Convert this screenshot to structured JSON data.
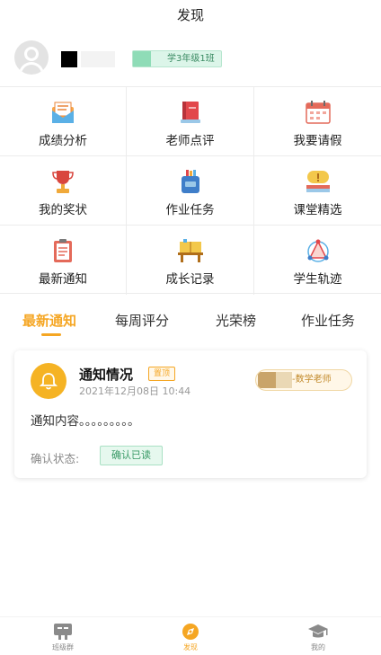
{
  "header": {
    "title": "发现"
  },
  "profile": {
    "class_name": "学3年级1班"
  },
  "grid": {
    "items": [
      {
        "label": "成绩分析",
        "icon": "score-analysis-icon"
      },
      {
        "label": "老师点评",
        "icon": "teacher-comment-icon"
      },
      {
        "label": "我要请假",
        "icon": "calendar-leave-icon"
      },
      {
        "label": "我的奖状",
        "icon": "trophy-icon"
      },
      {
        "label": "作业任务",
        "icon": "homework-bag-icon"
      },
      {
        "label": "课堂精选",
        "icon": "class-highlight-icon"
      },
      {
        "label": "最新通知",
        "icon": "clipboard-notice-icon"
      },
      {
        "label": "成长记录",
        "icon": "growth-record-icon"
      },
      {
        "label": "学生轨迹",
        "icon": "student-trajectory-icon"
      }
    ]
  },
  "tabs": [
    "最新通知",
    "每周评分",
    "光荣榜",
    "作业任务"
  ],
  "notice": {
    "title": "通知情况",
    "pin": "置顶",
    "time": "2021年12月08日 10:44",
    "teacher": "-数学老师",
    "content": "通知内容。。。。。。。。。",
    "confirm_label": "确认状态:",
    "confirm_status": "确认已读"
  },
  "bottom_nav": [
    {
      "label": "班级群",
      "icon": "class-group-icon"
    },
    {
      "label": "发现",
      "icon": "discover-compass-icon"
    },
    {
      "label": "我的",
      "icon": "graduation-cap-icon"
    }
  ],
  "colors": {
    "accent": "#f5a623",
    "green": "#3a9a67"
  }
}
